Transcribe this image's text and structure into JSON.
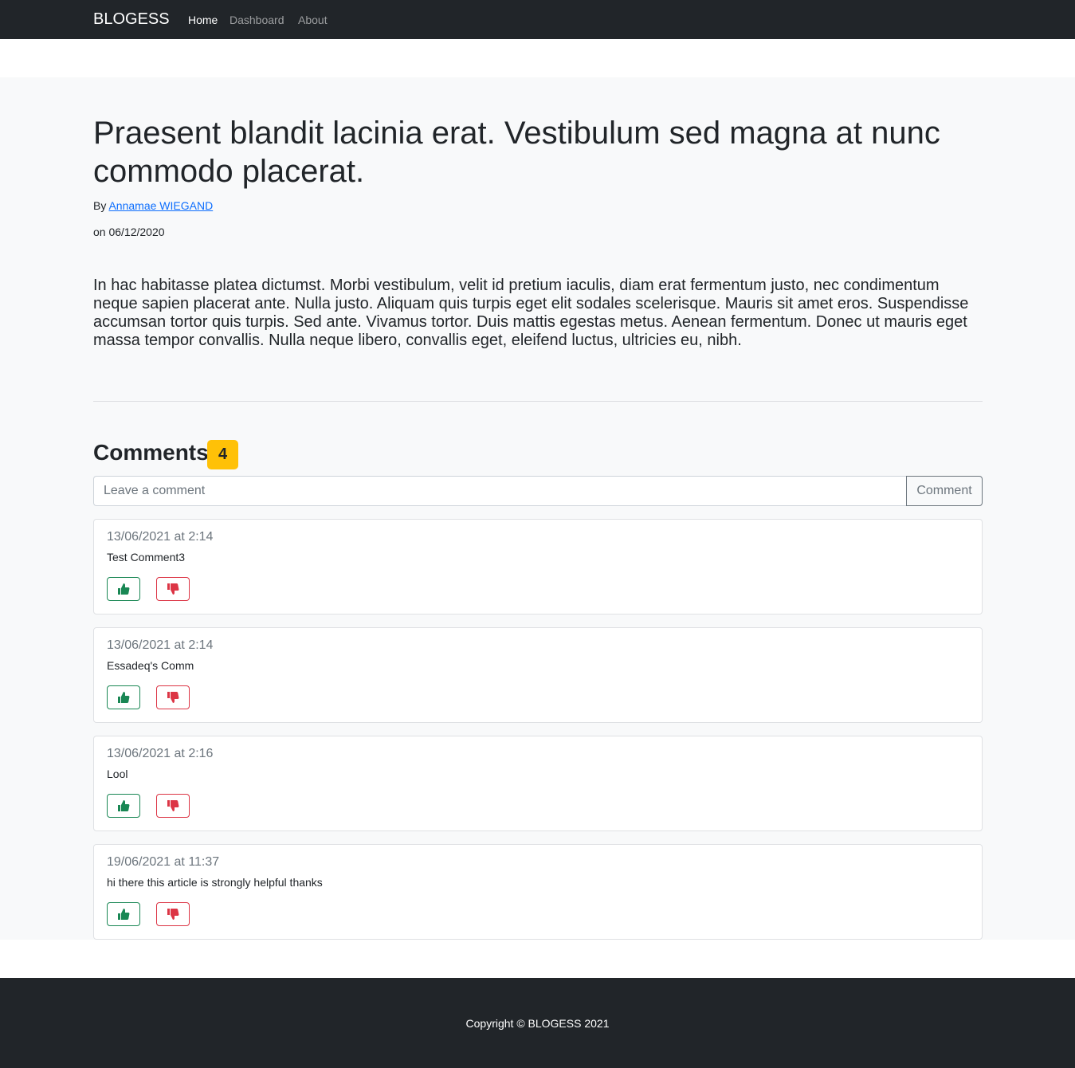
{
  "navbar": {
    "brand": "BLOGESS",
    "links": [
      {
        "label": "Home",
        "active": true
      },
      {
        "label": "Dashboard",
        "active": false
      },
      {
        "label": "About",
        "active": false
      }
    ]
  },
  "article": {
    "title": "Praesent blandit lacinia erat. Vestibulum sed magna at nunc commodo placerat.",
    "by_label": "By",
    "author": "Annamae WIEGAND",
    "date_text": "on 06/12/2020",
    "body": "In hac habitasse platea dictumst. Morbi vestibulum, velit id pretium iaculis, diam erat fermentum justo, nec condimentum neque sapien placerat ante. Nulla justo. Aliquam quis turpis eget elit sodales scelerisque. Mauris sit amet eros. Suspendisse accumsan tortor quis turpis. Sed ante. Vivamus tortor. Duis mattis egestas metus. Aenean fermentum. Donec ut mauris eget massa tempor convallis. Nulla neque libero, convallis eget, eleifend luctus, ultricies eu, nibh."
  },
  "comments": {
    "heading": "Comments",
    "count": "4",
    "input_placeholder": "Leave a comment",
    "submit_label": "Comment",
    "items": [
      {
        "date": "13/06/2021 at 2:14",
        "text": "Test Comment3"
      },
      {
        "date": "13/06/2021 at 2:14",
        "text": "Essadeq's Comm"
      },
      {
        "date": "13/06/2021 at 2:16",
        "text": "Lool"
      },
      {
        "date": "19/06/2021 at 11:37",
        "text": "hi there this article is strongly helpful thanks"
      }
    ],
    "like_icon": "thumbs-up-icon",
    "dislike_icon": "thumbs-down-icon"
  },
  "footer": {
    "copyright": "Copyright © BLOGESS 2021"
  },
  "colors": {
    "navbar_bg": "#212529",
    "main_bg": "#f8f9fa",
    "badge": "#ffc107",
    "like": "#198754",
    "dislike": "#dc3545",
    "link": "#0d6efd"
  }
}
